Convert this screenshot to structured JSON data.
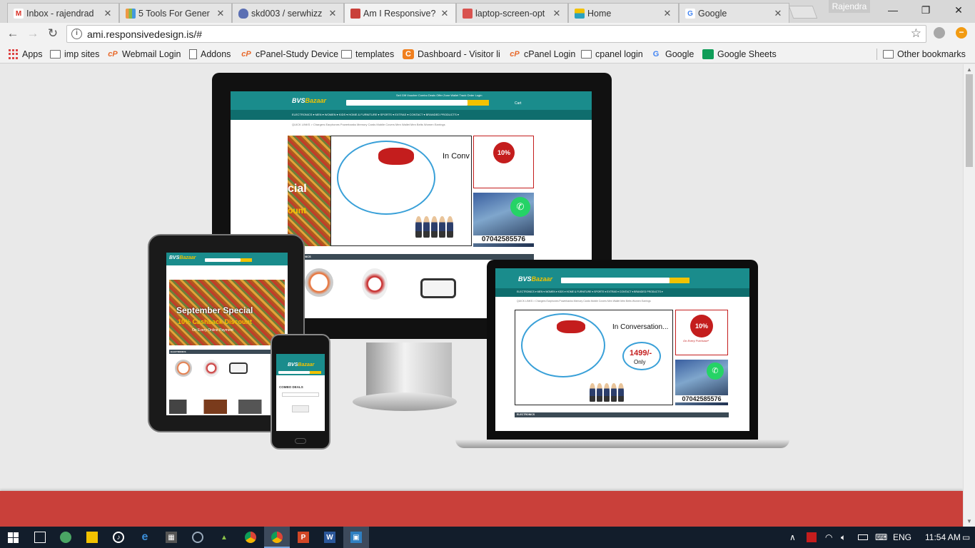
{
  "browser": {
    "tabs": [
      {
        "label": "Inbox - rajendrad",
        "favicon": "gmail-icon",
        "fav_glyph": "M",
        "fav_color": "#d93025",
        "active": false
      },
      {
        "label": "5 Tools For Gener",
        "favicon": "colorful-grid-icon",
        "fav_glyph": "",
        "fav_color": "#8ab34a",
        "active": false
      },
      {
        "label": "skd003 / serwhizz",
        "favicon": "shield-icon",
        "fav_glyph": "",
        "fav_color": "#5b6fb3",
        "active": false
      },
      {
        "label": "Am I Responsive?",
        "favicon": "responsive-icon",
        "fav_glyph": "",
        "fav_color": "#c9403a",
        "active": true
      },
      {
        "label": "laptop-screen-opt",
        "favicon": "responsive-icon",
        "fav_glyph": "",
        "fav_color": "#d9534f",
        "active": false
      },
      {
        "label": "Home",
        "favicon": "bvs-icon",
        "fav_glyph": "",
        "fav_color": "#2aa1c0",
        "active": false
      },
      {
        "label": "Google",
        "favicon": "google-icon",
        "fav_glyph": "G",
        "fav_color": "#4285f4",
        "active": false
      }
    ],
    "profile_name": "Rajendra",
    "url": "ami.responsivedesign.is/#",
    "bookmarks": [
      {
        "label": "Apps",
        "icon": "apps-icon"
      },
      {
        "label": "imp sites",
        "icon": "folder-icon"
      },
      {
        "label": "Webmail Login",
        "icon": "cpanel-icon"
      },
      {
        "label": "Addons",
        "icon": "page-icon"
      },
      {
        "label": "cPanel-Study Device",
        "icon": "cpanel-icon"
      },
      {
        "label": "templates",
        "icon": "folder-icon"
      },
      {
        "label": "Dashboard - Visitor lis",
        "icon": "orange-c-icon"
      },
      {
        "label": "cPanel Login",
        "icon": "cpanel-icon"
      },
      {
        "label": "cpanel login",
        "icon": "folder-icon"
      },
      {
        "label": "Google",
        "icon": "google-icon"
      },
      {
        "label": "Google Sheets",
        "icon": "sheets-icon"
      }
    ],
    "other_bookmarks": "Other bookmarks"
  },
  "preview": {
    "logo_text": "BVS",
    "logo_accent": "Bazaar",
    "conversation": "In Conversation...",
    "conversation_short": "In Conv",
    "price": "1499/-",
    "price_only": "Only",
    "cashback": "10%",
    "cashback_small": "CASHBACK",
    "cashback_caption": "On Every Purchase*",
    "phone": "07042585576",
    "tablet_banner_title": "September Special",
    "tablet_banner_sub": "10% Cashback Discount",
    "tablet_banner_caption": "On Every Online Payment",
    "desktop_banner_partial_1": "cial",
    "desktop_banner_partial_2": "ount",
    "electronics": "ELECTRONICS",
    "combo": "COMBO DEALS",
    "crumbs": "QUICK LINKS  >  Chargers   Earphones   Powerbanks   Memory Cards   Mobile Covers   Men Wallet   Men Belts   Women Earrings",
    "nav_links": "ELECTRONICS ▾   MEN ▾   WOMEN ▾   KIDS ▾   HOME & FURNITURE ▾   SPORTS ▾   EXTRAS ▾   CONTACT ▾   BRANDED PRODUCTS ▾",
    "top_links": "Sell   Gift Voucher   Combo Deals   Offer Zone   Wallet   Track Order   Login",
    "search_placeholder": "Search Products...",
    "search_btn": "Best Offer",
    "cart": "Cart"
  },
  "colors": {
    "accent_red": "#c9403a",
    "site_teal": "#1a8c8c",
    "site_yellow": "#f2c200"
  },
  "taskbar": {
    "apps": [
      "start-icon",
      "task-view-icon",
      "people-icon",
      "file-explorer-icon",
      "media-player-icon",
      "edge-icon",
      "calculator-icon",
      "settings-icon",
      "android-icon",
      "chrome-icon",
      "chrome-active-icon",
      "powerpoint-icon",
      "word-icon",
      "remote-desktop-icon"
    ],
    "language": "ENG",
    "time": "11:54 AM"
  }
}
